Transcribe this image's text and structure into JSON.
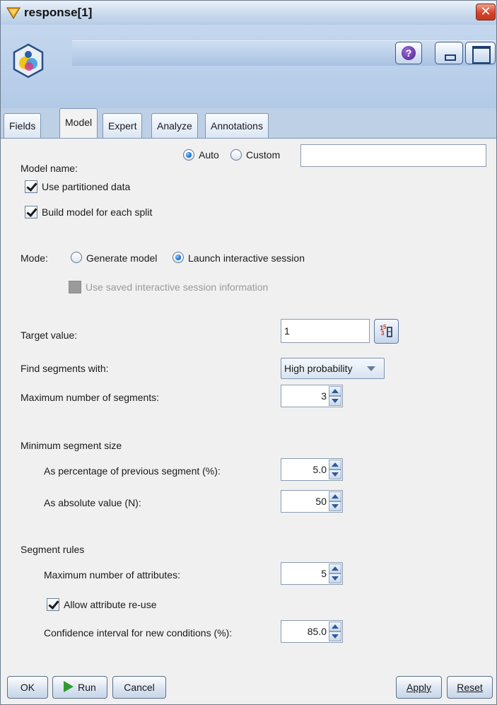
{
  "window": {
    "title": "response[1]"
  },
  "tabs": [
    {
      "label": "Fields",
      "active": false
    },
    {
      "label": "Model",
      "active": true
    },
    {
      "label": "Expert",
      "active": false
    },
    {
      "label": "Analyze",
      "active": false
    },
    {
      "label": "Annotations",
      "active": false
    }
  ],
  "model": {
    "model_name_label": "Model name:",
    "auto_label": "Auto",
    "custom_label": "Custom",
    "custom_name_value": "",
    "use_partitioned_label": "Use partitioned data",
    "build_each_split_label": "Build model for each split",
    "mode_label": "Mode:",
    "generate_model_label": "Generate model",
    "launch_interactive_label": "Launch interactive session",
    "use_saved_label": "Use saved interactive session information",
    "target_value_label": "Target value:",
    "target_value": "1",
    "find_segments_label": "Find segments with:",
    "find_segments_value": "High probability",
    "max_segments_label": "Maximum number of segments:",
    "max_segments_value": "3",
    "min_segment_size_label": "Minimum segment size",
    "pct_prev_label": "As percentage of previous segment (%):",
    "pct_prev_value": "5.0",
    "abs_value_label": "As absolute value (N):",
    "abs_value": "50",
    "segment_rules_label": "Segment rules",
    "max_attributes_label": "Maximum number of attributes:",
    "max_attributes_value": "5",
    "allow_reuse_label": "Allow attribute re-use",
    "confidence_label": "Confidence interval for new conditions (%):",
    "confidence_value": "85.0"
  },
  "buttons": {
    "ok": "OK",
    "run": "Run",
    "cancel": "Cancel",
    "apply": "Apply",
    "reset": "Reset"
  },
  "icons": [
    "node-icon",
    "help-icon",
    "minimize-icon",
    "maximize-icon",
    "close-icon",
    "value-picker-icon",
    "run-play-icon"
  ],
  "colors": {
    "title_bar": "#c8d8ec",
    "close_button": "#d4432a",
    "run_play": "#2f9a2f",
    "radio_selected": "#1a6fd0"
  }
}
